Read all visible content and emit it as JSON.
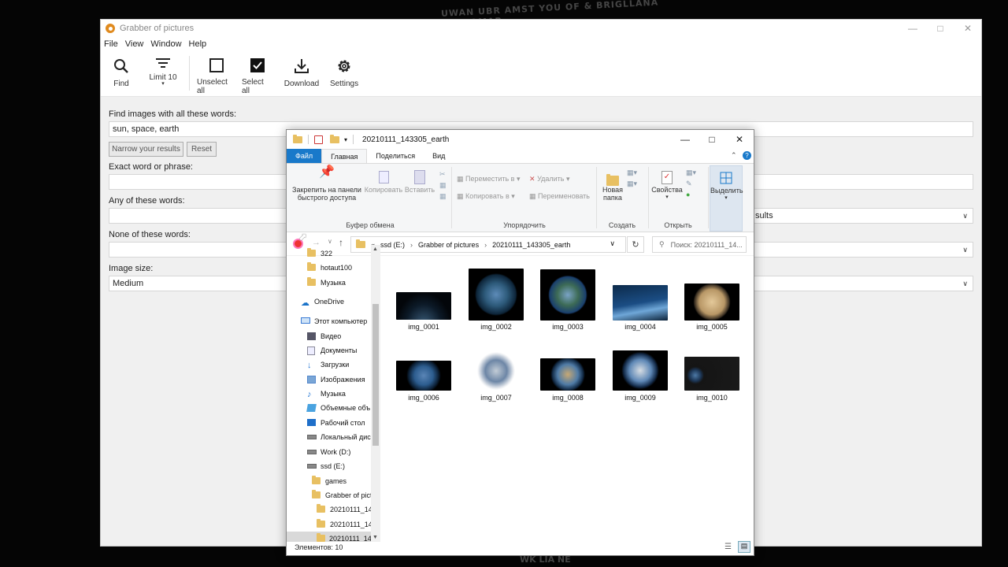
{
  "background": {
    "text_top": "UWAN UBR AMST YOU OF & BRIGLLANA TYANOMAR",
    "text_bottom": "WK LIA NE"
  },
  "app": {
    "title": "Grabber of pictures",
    "menu": [
      "File",
      "View",
      "Window",
      "Help"
    ],
    "toolbar": {
      "find": "Find",
      "limit": "Limit 10",
      "unselect_all": "Unselect all",
      "select_all": "Select all",
      "download": "Download",
      "settings": "Settings"
    },
    "form": {
      "all_words_label": "Find images with all these words:",
      "all_words_value": "sun, space, earth",
      "narrow_button": "Narrow your results",
      "reset_button": "Reset",
      "exact_label": "Exact word or phrase:",
      "any_label": "Any of these words:",
      "any_select_partial": "sults",
      "none_label": "None of these words:",
      "size_label": "Image size:",
      "size_value": "Medium"
    }
  },
  "explorer": {
    "title": "20210111_143305_earth",
    "tabs": {
      "file": "Файл",
      "home": "Главная",
      "share": "Поделиться",
      "view": "Вид"
    },
    "ribbon": {
      "pin": "Закрепить на панели быстрого доступа",
      "copy": "Копировать",
      "paste": "Вставить",
      "clipboard_group": "Буфер обмена",
      "move_to": "Переместить в",
      "copy_to": "Копировать в",
      "delete": "Удалить",
      "rename": "Переименовать",
      "organize_group": "Упорядочить",
      "new_folder": "Новая папка",
      "create_group": "Создать",
      "properties": "Свойства",
      "open_group": "Открыть",
      "select": "Выделить"
    },
    "address": {
      "prefix": "«",
      "parts": [
        "ssd (E:)",
        "Grabber of pictures",
        "20210111_143305_earth"
      ]
    },
    "search_placeholder": "Поиск: 20210111_14...",
    "nav": [
      {
        "label": "322",
        "type": "folder"
      },
      {
        "label": "hotaut100",
        "type": "folder"
      },
      {
        "label": "Музыка",
        "type": "folder"
      },
      {
        "label": "OneDrive",
        "type": "cloud"
      },
      {
        "label": "Этот компьютер",
        "type": "pc"
      },
      {
        "label": "Видео",
        "type": "video"
      },
      {
        "label": "Документы",
        "type": "docs"
      },
      {
        "label": "Загрузки",
        "type": "down"
      },
      {
        "label": "Изображения",
        "type": "pics"
      },
      {
        "label": "Музыка",
        "type": "music"
      },
      {
        "label": "Объемные объ",
        "type": "3d"
      },
      {
        "label": "Рабочий стол",
        "type": "desk"
      },
      {
        "label": "Локальный дис",
        "type": "drive"
      },
      {
        "label": "Work (D:)",
        "type": "drive"
      },
      {
        "label": "ssd (E:)",
        "type": "drive"
      },
      {
        "label": "games",
        "type": "folder"
      },
      {
        "label": "Grabber of pict",
        "type": "folder"
      },
      {
        "label": "20210111_143",
        "type": "folder"
      },
      {
        "label": "20210111_143",
        "type": "folder"
      },
      {
        "label": "20210111_143",
        "type": "folder"
      }
    ],
    "files": [
      "img_0001",
      "img_0002",
      "img_0003",
      "img_0004",
      "img_0005",
      "img_0006",
      "img_0007",
      "img_0008",
      "img_0009",
      "img_0010"
    ],
    "status": "Элементов: 10",
    "colors": {
      "file_tab": "#1979ca",
      "folder": "#e8c062"
    }
  }
}
